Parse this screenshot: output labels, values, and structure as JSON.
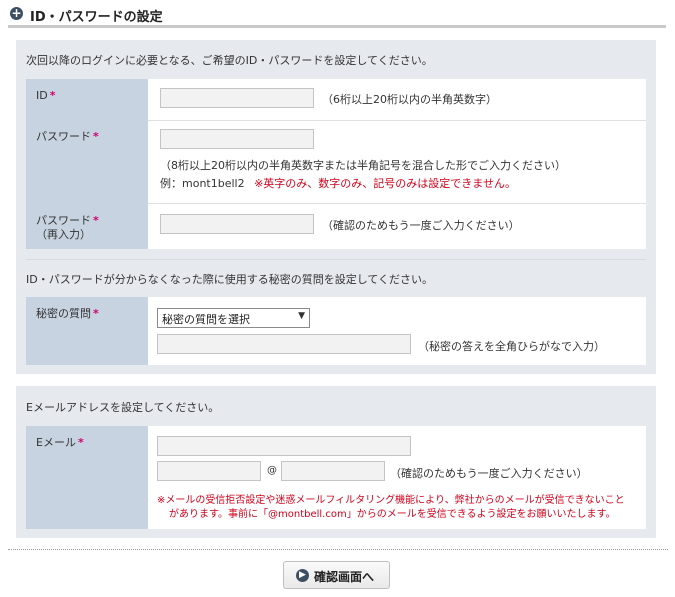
{
  "header": {
    "icon": "plus-circle-icon",
    "title": "ID・パスワードの設定"
  },
  "section1": {
    "intro": "次回以降のログインに必要となる、ご希望のID・パスワードを設定してください。",
    "id_row": {
      "label": "ID",
      "required": "*",
      "note": "（6桁以上20桁以内の半角英数字）"
    },
    "password_row": {
      "label": "パスワード",
      "required": "*",
      "note": "（8桁以上20桁以内の半角英数字または半角記号を混合した形でご入力ください）",
      "example": "例：mont1bell2",
      "warning": "※英字のみ、数字のみ、記号のみは設定できません。"
    },
    "password_confirm_row": {
      "label": "パスワード",
      "required": "*",
      "sublabel": "（再入力）",
      "note": "（確認のためもう一度ご入力ください）"
    }
  },
  "section2": {
    "intro": "ID・パスワードが分からなくなった際に使用する秘密の質問を設定してください。",
    "secret_row": {
      "label": "秘密の質問",
      "required": "*",
      "select_value": "秘密の質問を選択",
      "note": "（秘密の答えを全角ひらがなで入力）"
    }
  },
  "section3": {
    "intro": "Eメールアドレスを設定してください。",
    "email_row": {
      "label": "Eメール",
      "required": "*",
      "at": "@",
      "confirm_note": "（確認のためもう一度ご入力ください）",
      "warning_line1": "※メールの受信拒否設定や迷惑メールフィルタリング機能により、弊社からのメールが受信できないこと",
      "warning_line2": "があります。事前に「@montbell.com」からのメールを受信できるよう設定をお願いいたします。"
    }
  },
  "submit": {
    "icon": "arrow-right-circle-icon",
    "label": "確認画面へ"
  }
}
